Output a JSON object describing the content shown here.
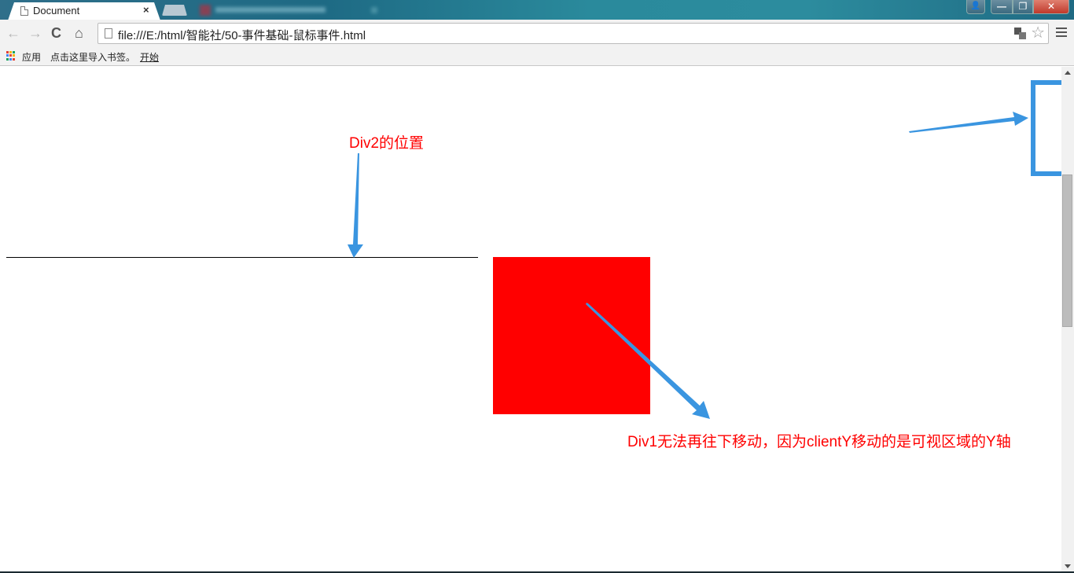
{
  "browser": {
    "active_tab": {
      "title": "Document",
      "close_label": "×"
    },
    "background_tab": {
      "title": ""
    },
    "window_controls": {
      "user": "👤",
      "minimize": "—",
      "maximize": "❐",
      "close": "✕"
    },
    "nav": {
      "back": "←",
      "forward": "→",
      "reload": "C",
      "home": "⌂"
    },
    "address_bar": {
      "url": "file:///E:/html/智能社/50-事件基础-鼠标事件.html"
    },
    "bookmark_star": "☆",
    "bookmarks": [
      {
        "label": "应用"
      },
      {
        "label": "点击这里导入书签。"
      },
      {
        "label": "开始"
      }
    ],
    "apps_icon_colors": [
      "#e44134",
      "#f5b400",
      "#1aa260",
      "#4285f4",
      "#e44134",
      "#f5b400",
      "#1aa260",
      "#4285f4",
      "#e44134"
    ]
  },
  "page": {
    "annotations": {
      "div2_label": "Div2的位置",
      "div1_label": "Div1无法再往下移动，因为clientY移动的是可视区域的Y轴"
    },
    "colors": {
      "div1_fill": "#ff0000",
      "annotation_text": "#ff0000",
      "arrow": "#3a95e0",
      "div2_line": "#000000"
    }
  }
}
